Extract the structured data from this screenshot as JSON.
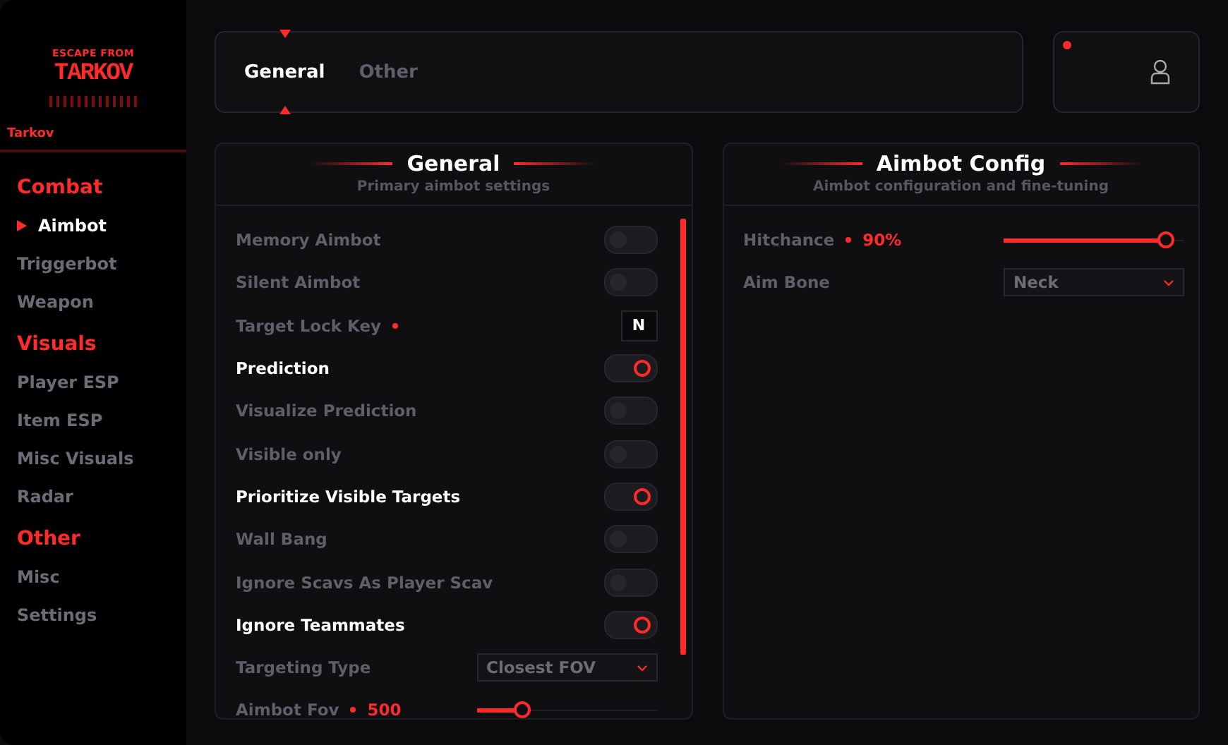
{
  "sidebar": {
    "logo": [
      "ESCAPE FROM",
      "TARKOV"
    ],
    "game": "Tarkov",
    "sections": [
      {
        "title": "Combat",
        "items": [
          {
            "label": "Aimbot",
            "selected": true
          },
          {
            "label": "Triggerbot",
            "selected": false
          },
          {
            "label": "Weapon",
            "selected": false
          }
        ]
      },
      {
        "title": "Visuals",
        "items": [
          {
            "label": "Player ESP",
            "selected": false
          },
          {
            "label": "Item ESP",
            "selected": false
          },
          {
            "label": "Misc Visuals",
            "selected": false
          },
          {
            "label": "Radar",
            "selected": false
          }
        ]
      },
      {
        "title": "Other",
        "items": [
          {
            "label": "Misc",
            "selected": false
          },
          {
            "label": "Settings",
            "selected": false
          }
        ]
      }
    ]
  },
  "tabs": [
    {
      "label": "General",
      "selected": true
    },
    {
      "label": "Other",
      "selected": false
    }
  ],
  "panels": [
    {
      "title": "General",
      "subtitle": "Primary aimbot settings",
      "scrollable": true,
      "rows": [
        {
          "kind": "toggle",
          "label": "Memory Aimbot",
          "on": false
        },
        {
          "kind": "toggle",
          "label": "Silent Aimbot",
          "on": false
        },
        {
          "kind": "key",
          "label": "Target Lock Key",
          "key": "N"
        },
        {
          "kind": "toggle",
          "label": "Prediction",
          "on": true
        },
        {
          "kind": "toggle",
          "label": "Visualize Prediction",
          "on": false
        },
        {
          "kind": "toggle",
          "label": "Visible only",
          "on": false
        },
        {
          "kind": "toggle",
          "label": "Prioritize Visible Targets",
          "on": true
        },
        {
          "kind": "toggle",
          "label": "Wall Bang",
          "on": false
        },
        {
          "kind": "toggle",
          "label": "Ignore Scavs As Player Scav",
          "on": false
        },
        {
          "kind": "toggle",
          "label": "Ignore Teammates",
          "on": true
        },
        {
          "kind": "select",
          "label": "Targeting Type",
          "value": "Closest FOV"
        },
        {
          "kind": "slider",
          "label": "Aimbot Fov",
          "reading": "500",
          "level": 0.25
        }
      ]
    },
    {
      "title": "Aimbot Config",
      "subtitle": "Aimbot configuration and fine-tuning",
      "scrollable": false,
      "rows": [
        {
          "kind": "slider",
          "label": "Hitchance",
          "reading": "90%",
          "level": 0.9
        },
        {
          "kind": "select",
          "label": "Aim Bone",
          "value": "Neck"
        }
      ]
    }
  ]
}
